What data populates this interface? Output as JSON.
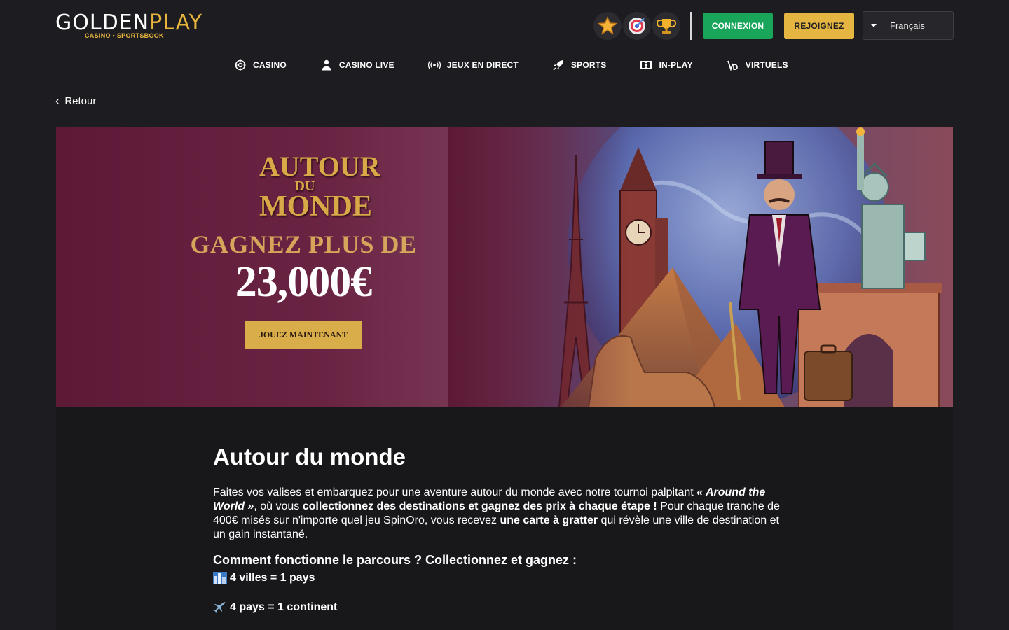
{
  "header": {
    "logo_main": "GOLDEN",
    "logo_play": "PLAY",
    "logo_sub": "CASINO • SPORTSBOOK",
    "badges": [
      "star-badge-icon",
      "target-badge-icon",
      "trophy-badge-icon"
    ],
    "login_label": "CONNEXION",
    "join_label": "REJOIGNEZ",
    "language": "Français"
  },
  "nav": {
    "items": [
      {
        "label": "CASINO",
        "icon": "chip-icon"
      },
      {
        "label": "CASINO LIVE",
        "icon": "dealer-icon"
      },
      {
        "label": "JEUX EN DIRECT",
        "icon": "broadcast-icon"
      },
      {
        "label": "SPORTS",
        "icon": "rocket-icon"
      },
      {
        "label": "IN-PLAY",
        "icon": "scoreboard-icon"
      },
      {
        "label": "VIRTUELS",
        "icon": "virtual-icon"
      }
    ]
  },
  "back_label": "Retour",
  "banner": {
    "title_line1": "AUTOUR",
    "title_line2": "DU",
    "title_line3": "MONDE",
    "win_text": "GAGNEZ PLUS DE",
    "amount": "23,000€",
    "cta": "JOUEZ MAINTENANT"
  },
  "article": {
    "title": "Autour du monde",
    "p1_a": "Faites vos valises et embarquez pour une aventure autour du monde avec notre tournoi palpitant ",
    "p1_b": "« Around the World »",
    "p1_c": ", où vous ",
    "p1_d": "collectionnez des destinations et gagnez des prix à chaque étape !",
    "p1_e": " Pour chaque tranche de 400€ misés sur n'importe quel jeu SpinOro, vous recevez ",
    "p1_f": "une carte à gratter",
    "p1_g": " qui révèle une ville de destination et un gain instantané.",
    "subheading": "Comment fonctionne le parcours ? Collectionnez et gagnez :",
    "list": [
      {
        "icon": "cityscape-icon",
        "text": "4 villes = 1 pays"
      },
      {
        "icon": "airplane-icon",
        "text": "4 pays = 1 continent"
      }
    ]
  },
  "colors": {
    "background": "#1d1d21",
    "login": "#19a55a",
    "join": "#e4b541",
    "gold": "#d9ad4a"
  }
}
